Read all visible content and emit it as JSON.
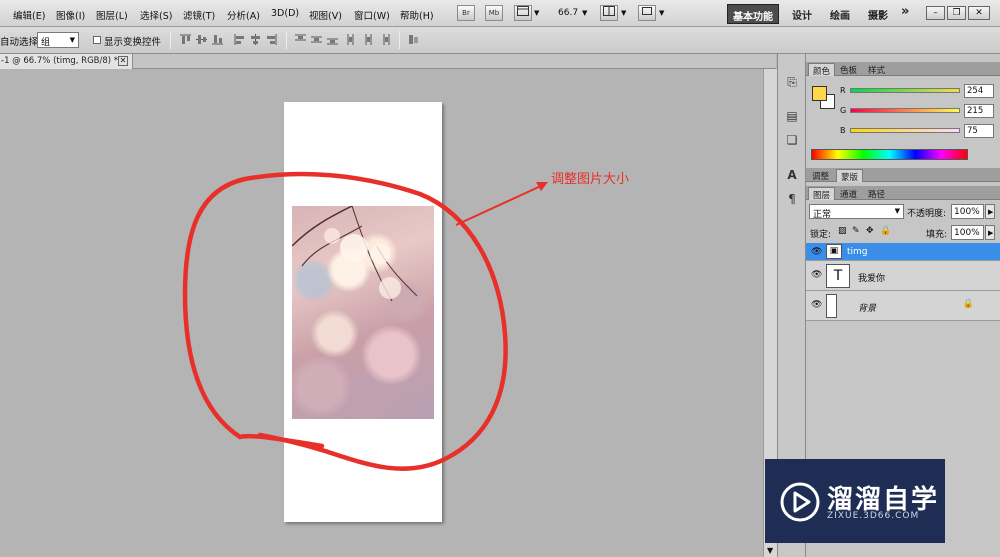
{
  "menubar": {
    "items": [
      "编辑(E)",
      "图像(I)",
      "图层(L)",
      "选择(S)",
      "滤镜(T)",
      "分析(A)",
      "3D(D)",
      "视图(V)",
      "窗口(W)",
      "帮助(H)"
    ],
    "br_icon": "Br",
    "mb_icon": "Mb",
    "zoom": "66.7",
    "workspaces": [
      "基本功能",
      "设计",
      "绘画",
      "摄影"
    ],
    "more": "»"
  },
  "options": {
    "auto_select_label": "自动选择:",
    "auto_select_value": "组",
    "show_transform_label": "显示变换控件"
  },
  "document_tab": {
    "title": "-1 @ 66.7% (timg, RGB/8) *"
  },
  "annotation": {
    "text": "调整图片大小",
    "color": "#e8302a"
  },
  "panels": {
    "color_tabs": [
      "颜色",
      "色板",
      "样式"
    ],
    "color": {
      "r": "254",
      "g": "215",
      "b": "75",
      "fg": "#fed74b"
    },
    "adjust_tabs": [
      "调整",
      "蒙版"
    ],
    "layers_tabs": [
      "图层",
      "通道",
      "路径"
    ],
    "blend_mode": "正常",
    "opacity_label": "不透明度:",
    "opacity_value": "100%",
    "lock_label": "锁定:",
    "fill_label": "填充:",
    "fill_value": "100%",
    "layers": [
      {
        "name": "timg",
        "type": "smart-object",
        "selected": true
      },
      {
        "name": "我爱你",
        "type": "text",
        "selected": false
      },
      {
        "name": "背景",
        "type": "background",
        "selected": false,
        "locked": true
      }
    ]
  },
  "watermark": {
    "title": "溜溜自学",
    "url": "ZIXUE.3D66.COM"
  }
}
